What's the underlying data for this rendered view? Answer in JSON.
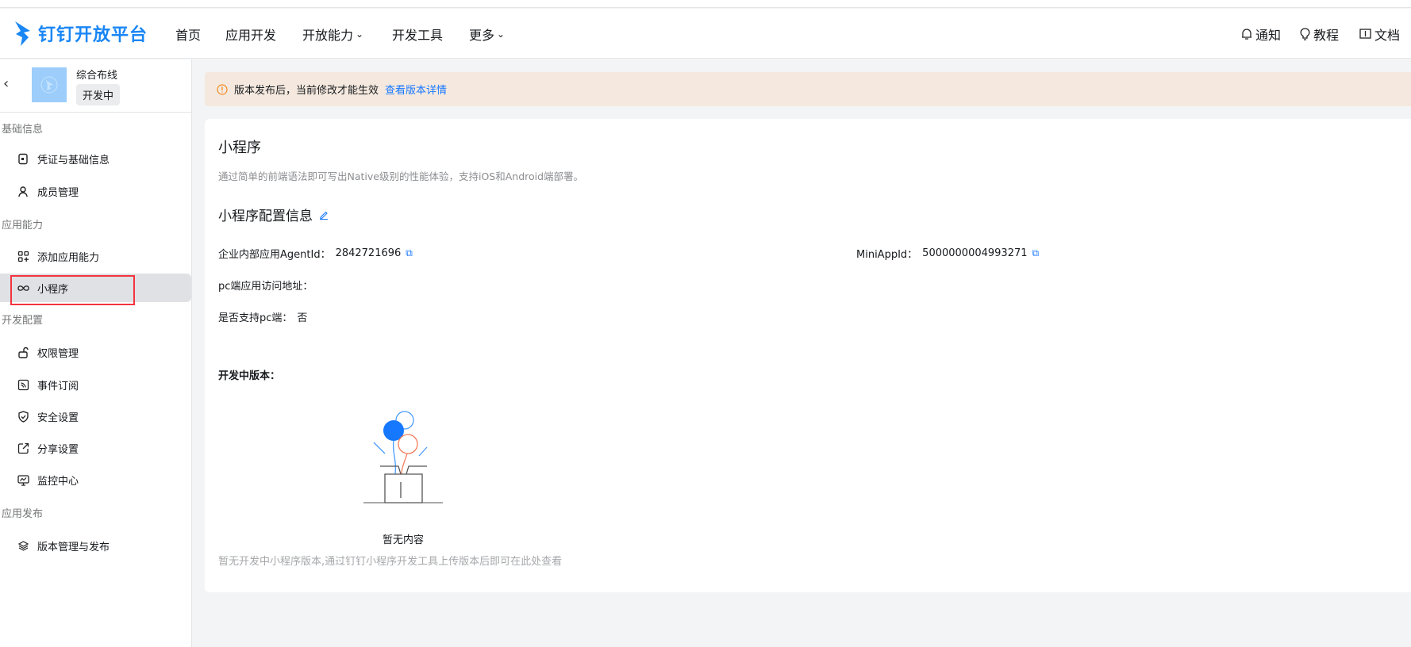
{
  "header": {
    "logo": "钉钉开放平台",
    "nav": [
      {
        "label": "首页"
      },
      {
        "label": "应用开发"
      },
      {
        "label": "开放能力",
        "dropdown": true
      },
      {
        "label": "开发工具"
      },
      {
        "label": "更多",
        "dropdown": true
      }
    ],
    "right": [
      {
        "label": "通知",
        "icon": "bell-icon"
      },
      {
        "label": "教程",
        "icon": "bulb-icon"
      },
      {
        "label": "文档",
        "icon": "book-icon"
      }
    ]
  },
  "app": {
    "name": "综合布线",
    "status": "开发中"
  },
  "sidebar": {
    "groups": [
      {
        "label": "基础信息",
        "items": [
          {
            "label": "凭证与基础信息"
          },
          {
            "label": "成员管理"
          }
        ]
      },
      {
        "label": "应用能力",
        "items": [
          {
            "label": "添加应用能力"
          },
          {
            "label": "小程序",
            "active": true
          }
        ]
      },
      {
        "label": "开发配置",
        "items": [
          {
            "label": "权限管理"
          },
          {
            "label": "事件订阅"
          },
          {
            "label": "安全设置"
          },
          {
            "label": "分享设置"
          },
          {
            "label": "监控中心"
          }
        ]
      },
      {
        "label": "应用发布",
        "items": [
          {
            "label": "版本管理与发布"
          }
        ]
      }
    ]
  },
  "banner": {
    "text": "版本发布后，当前修改才能生效",
    "link": "查看版本详情"
  },
  "main": {
    "title": "小程序",
    "description": "通过简单的前端语法即可写出Native级别的性能体验，支持iOS和Android端部署。",
    "config_title": "小程序配置信息",
    "agent_label": "企业内部应用AgentId：",
    "agent_value": "2842721696",
    "miniapp_label": "MiniAppId：",
    "miniapp_value": "5000000004993271",
    "pc_url_label": "pc端应用访问地址：",
    "pc_support_label": "是否支持pc端：",
    "pc_support_value": "否",
    "dev_version_label": "开发中版本：",
    "empty_title": "暂无内容",
    "empty_desc": "暂无开发中小程序版本,通过钉钉小程序开发工具上传版本后即可在此处查看"
  },
  "colors": {
    "accent": "#1677ff",
    "banner": "#f5e9df",
    "highlight": "#f5333f"
  }
}
